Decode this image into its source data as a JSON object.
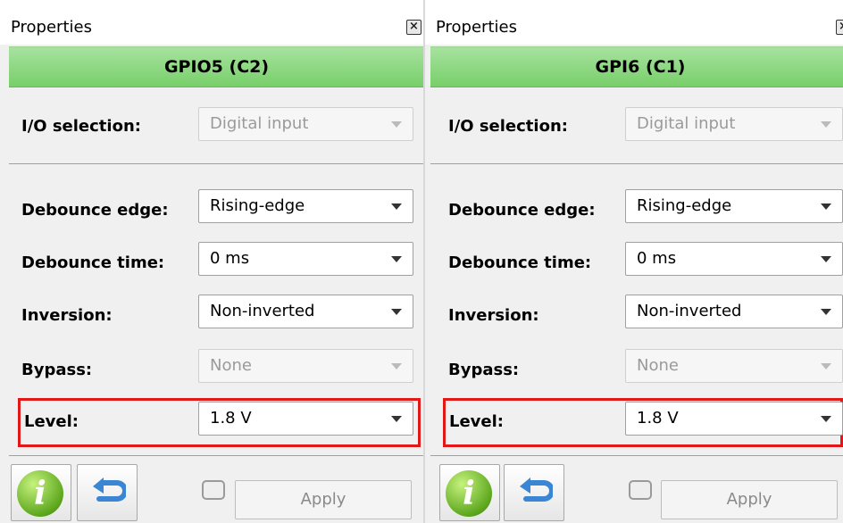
{
  "panels": [
    {
      "title": "Properties",
      "header": "GPIO5 (C2)",
      "io_selection": {
        "label": "I/O selection:",
        "value": "Digital input"
      },
      "debounce_edge": {
        "label": "Debounce edge:",
        "value": "Rising-edge"
      },
      "debounce_time": {
        "label": "Debounce time:",
        "value": "0 ms"
      },
      "inversion": {
        "label": "Inversion:",
        "value": "Non-inverted"
      },
      "bypass": {
        "label": "Bypass:",
        "value": "None"
      },
      "level": {
        "label": "Level:",
        "value": "1.8 V"
      },
      "apply_label": "Apply",
      "info_glyph": "i"
    },
    {
      "title": "Properties",
      "header": "GPI6 (C1)",
      "io_selection": {
        "label": "I/O selection:",
        "value": "Digital input"
      },
      "debounce_edge": {
        "label": "Debounce edge:",
        "value": "Rising-edge"
      },
      "debounce_time": {
        "label": "Debounce time:",
        "value": "0 ms"
      },
      "inversion": {
        "label": "Inversion:",
        "value": "Non-inverted"
      },
      "bypass": {
        "label": "Bypass:",
        "value": "None"
      },
      "level": {
        "label": "Level:",
        "value": "1.8 V"
      },
      "apply_label": "Apply",
      "info_glyph": "i"
    }
  ],
  "colors": {
    "header_green": "#86d67a",
    "highlight_red": "#e21818",
    "info_green": "#5ea81e",
    "undo_blue": "#3a86d4"
  },
  "icons": [
    "close-icon",
    "info-icon",
    "undo-icon",
    "revert-icon",
    "chevron-down-icon"
  ]
}
